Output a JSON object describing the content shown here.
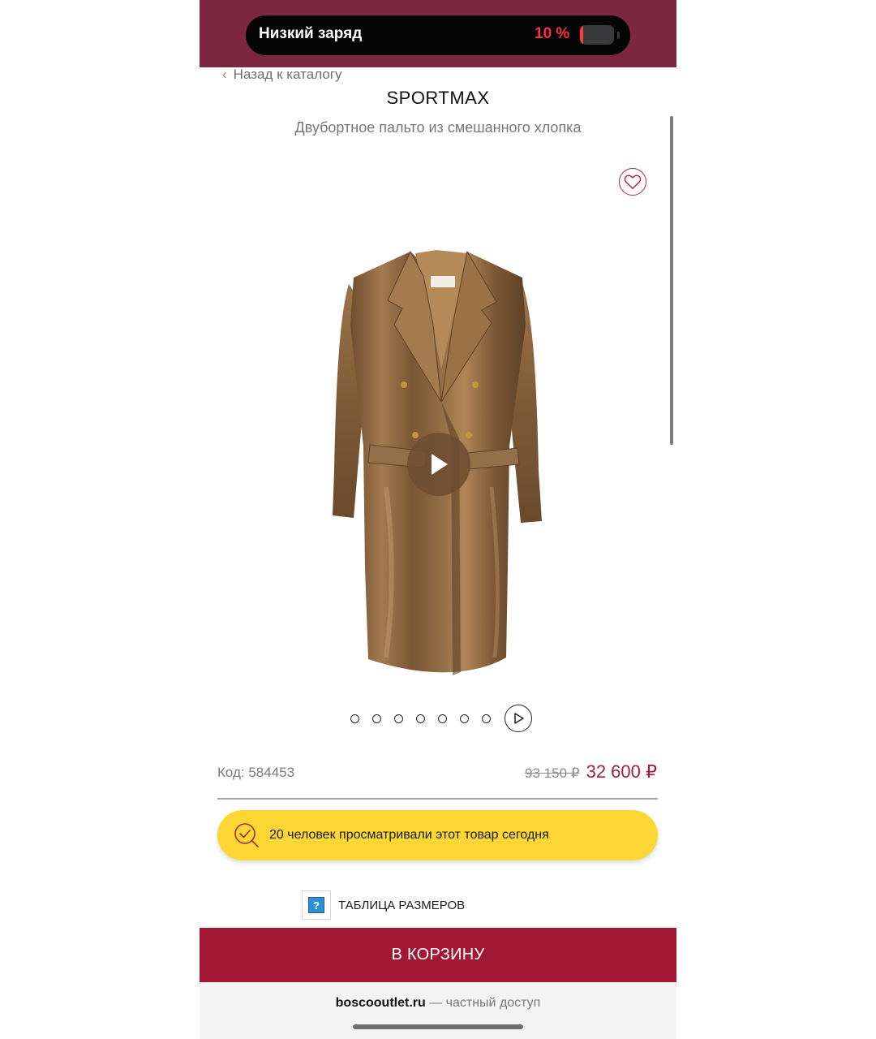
{
  "status_bar": {
    "low_charge_label": "Низкий заряд",
    "battery_percent": "10 %",
    "battery_level": 0.1,
    "background_color": "#7b2740"
  },
  "header": {
    "back_label": "Назад к каталогу",
    "brand": "SPORTMAX",
    "product_name": "Двубортное пальто из смешанного хлопка"
  },
  "gallery": {
    "image": "brown-satin-double-breasted-coat",
    "dots_count": 7,
    "play_icon": "play-icon",
    "favorite_icon": "heart-icon"
  },
  "product": {
    "code_label": "Код: 584453",
    "old_price": "93 150 ₽",
    "new_price": "32 600 ₽",
    "price_color": "#a0203d"
  },
  "views_banner": {
    "text": "20 человек просматривали этот товар сегодня",
    "background_color": "#fcd734"
  },
  "size_table": {
    "label": "ТАБЛИЦА РАЗМЕРОВ",
    "icon": "help-icon",
    "icon_text": "?"
  },
  "cart": {
    "label": "В КОРЗИНУ",
    "background_color": "#a21834"
  },
  "footer": {
    "domain": "boscooutlet.ru",
    "suffix": " — частный доступ"
  }
}
